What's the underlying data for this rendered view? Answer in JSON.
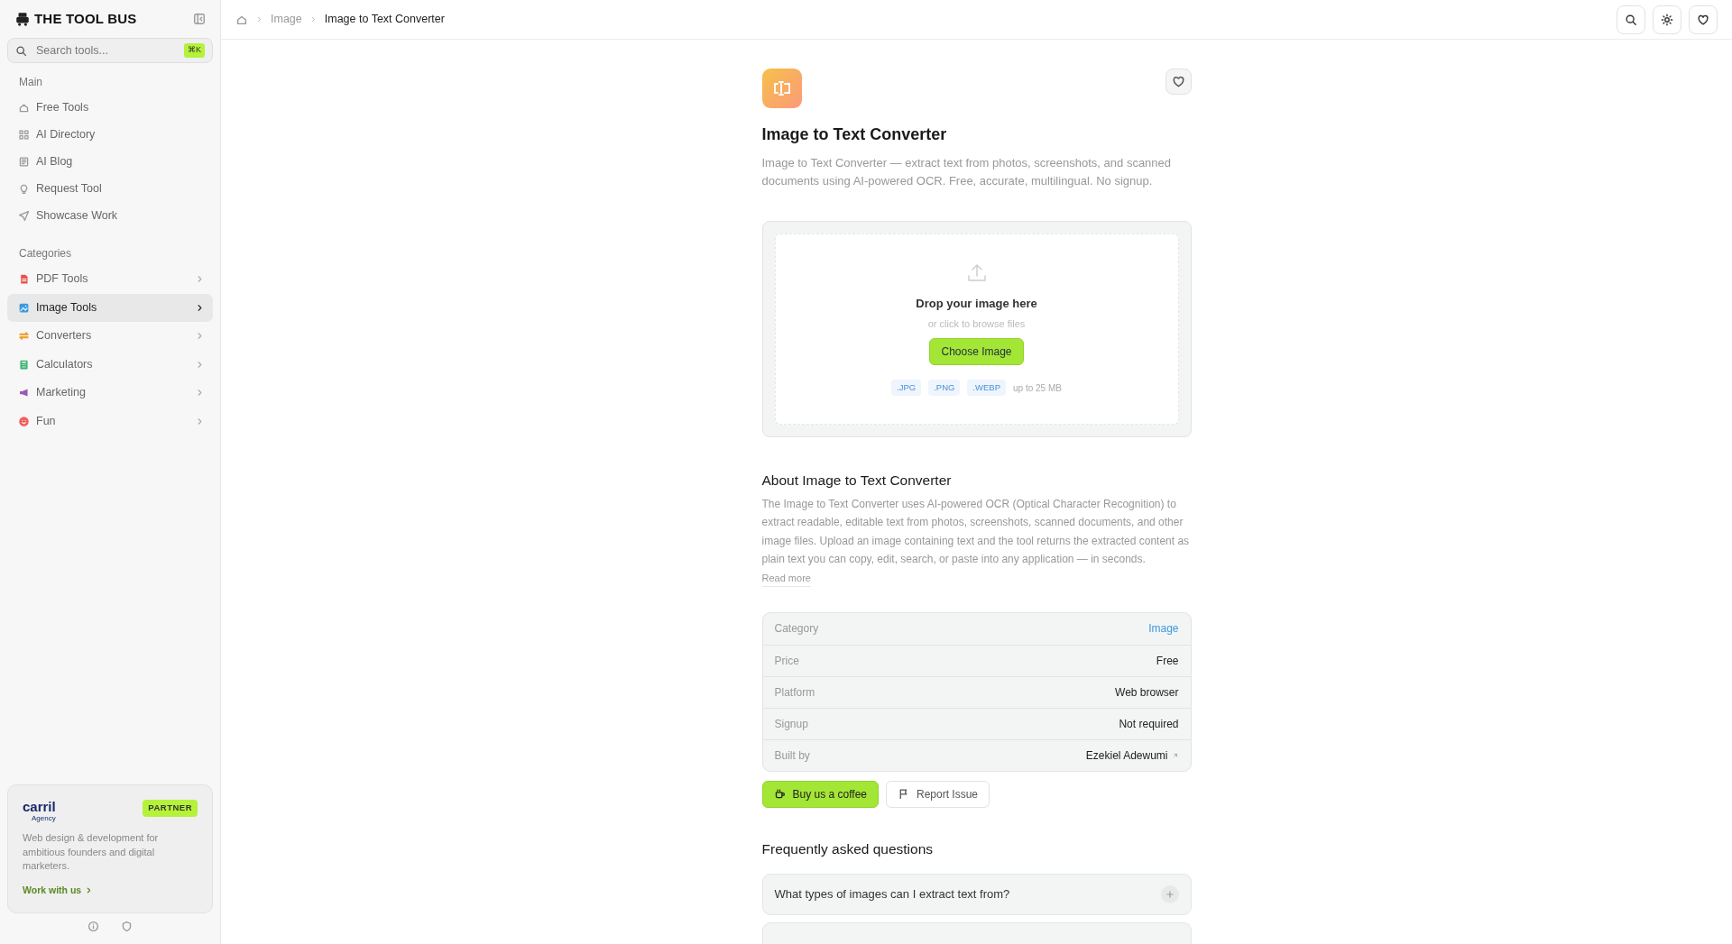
{
  "sidebar": {
    "logo": "THE TOOL BUS",
    "search": {
      "placeholder": "Search tools...",
      "shortcut": "⌘K"
    },
    "sections": [
      {
        "title": "Main",
        "kind": "links",
        "items": [
          {
            "label": "Free Tools",
            "selected": false
          },
          {
            "label": "AI Directory",
            "selected": false
          },
          {
            "label": "AI Blog",
            "selected": false
          },
          {
            "label": "Request Tool",
            "selected": false
          },
          {
            "label": "Showcase Work",
            "selected": false
          }
        ]
      },
      {
        "title": "Categories",
        "kind": "categories",
        "items": [
          {
            "label": "PDF Tools",
            "selected": false,
            "color": "#e5534b"
          },
          {
            "label": "Image Tools",
            "selected": true,
            "color": "#3b9ae1"
          },
          {
            "label": "Converters",
            "selected": false,
            "color": "#f0a030"
          },
          {
            "label": "Calculators",
            "selected": false,
            "color": "#3cb371"
          },
          {
            "label": "Marketing",
            "selected": false,
            "color": "#9b59b6"
          },
          {
            "label": "Fun",
            "selected": false,
            "color": "#f06060"
          }
        ]
      }
    ],
    "partner": {
      "logo": "carril",
      "logo_sub": "Agency",
      "badge": "PARTNER",
      "text": "Web design & development for ambitious founders and digital marketers.",
      "link": "Work with us"
    }
  },
  "breadcrumb": [
    {
      "label": "Image",
      "current": false
    },
    {
      "label": "Image to Text Converter",
      "current": true
    }
  ],
  "tool": {
    "title": "Image to Text Converter",
    "favorite": false,
    "description": "Image to Text Converter — extract text from photos, screenshots, and scanned documents using AI-powered OCR. Free, accurate, multilingual. No signup."
  },
  "upload": {
    "title": "Drop your image here",
    "hint": "or click to browse files",
    "button": "Choose Image",
    "formats": [
      ".JPG",
      ".PNG",
      ".WEBP"
    ],
    "limit": "up to 25 MB"
  },
  "about": {
    "heading": "About Image to Text Converter",
    "text": "The Image to Text Converter uses AI-powered OCR (Optical Character Recognition) to extract readable, editable text from photos, screenshots, scanned documents, and other image files. Upload an image containing text and the tool returns the extracted content as plain text you can copy, edit, search, or paste into any application — in seconds.",
    "read_more": "Read more"
  },
  "details": [
    {
      "label": "Category",
      "value": "Image",
      "kind": "link"
    },
    {
      "label": "Price",
      "value": "Free",
      "kind": "plain"
    },
    {
      "label": "Platform",
      "value": "Web browser",
      "kind": "plain"
    },
    {
      "label": "Signup",
      "value": "Not required",
      "kind": "plain"
    },
    {
      "label": "Built by",
      "value": "Ezekiel Adewumi",
      "kind": "external"
    }
  ],
  "actions": [
    {
      "label": "Buy us a coffee",
      "kind": "primary"
    },
    {
      "label": "Report Issue",
      "kind": "secondary"
    }
  ],
  "faq": {
    "heading": "Frequently asked questions",
    "items": [
      {
        "question": "What types of images can I extract text from?",
        "expanded": false
      }
    ]
  }
}
